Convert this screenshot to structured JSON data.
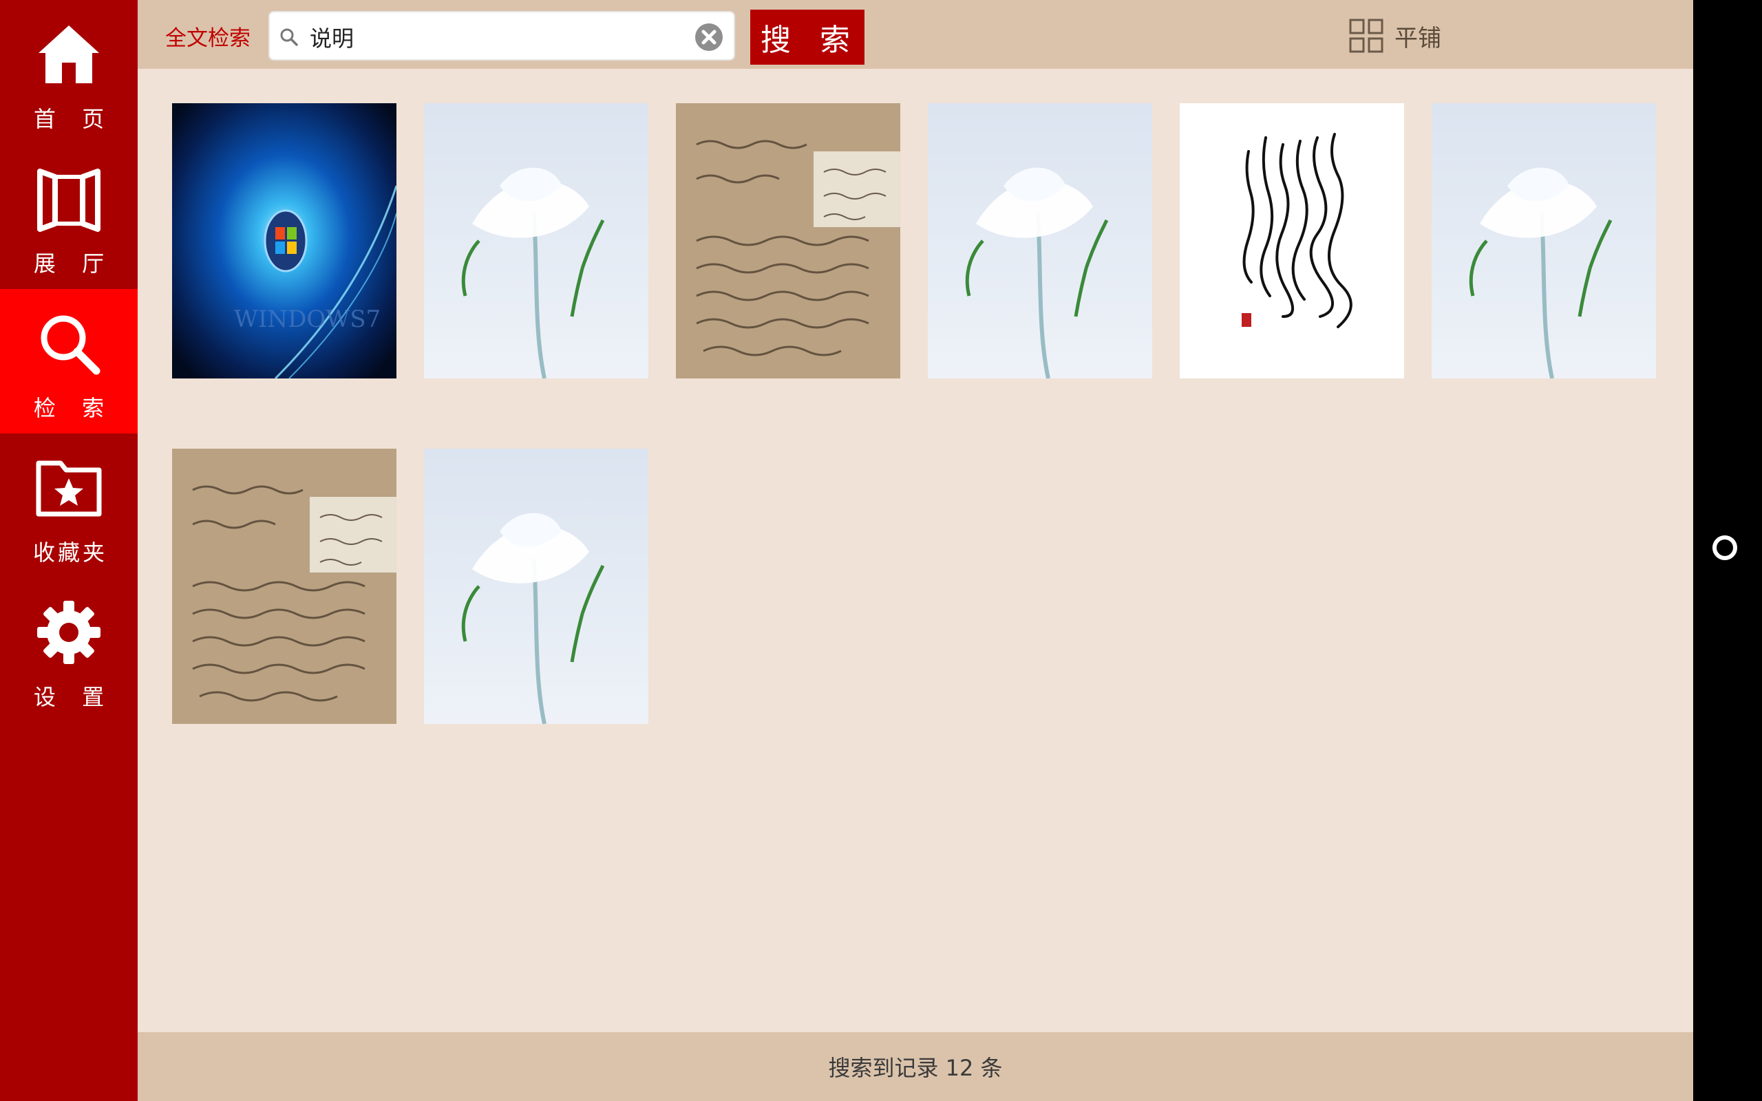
{
  "sidebar": {
    "items": [
      {
        "label": "首 页",
        "icon": "home-icon"
      },
      {
        "label": "展 厅",
        "icon": "gallery-icon"
      },
      {
        "label": "检 索",
        "icon": "search-icon",
        "active": true
      },
      {
        "label": "收藏夹",
        "icon": "favorites-folder-icon"
      },
      {
        "label": "设 置",
        "icon": "gear-icon"
      }
    ]
  },
  "topbar": {
    "search_mode": "全文检索",
    "search_value": "说明",
    "search_button": "搜 索",
    "view_toggle": "平铺"
  },
  "results": {
    "items": [
      {
        "kind": "windows7-wallpaper",
        "caption_art": "WINDOWS7"
      },
      {
        "kind": "snow-plant-photo"
      },
      {
        "kind": "handwritten-letter-scan"
      },
      {
        "kind": "snow-plant-photo"
      },
      {
        "kind": "calligraphy-scroll"
      },
      {
        "kind": "snow-plant-photo"
      },
      {
        "kind": "handwritten-letter-scan"
      },
      {
        "kind": "snow-plant-photo"
      }
    ]
  },
  "status": {
    "text": "搜索到记录 12 条"
  },
  "colors": {
    "sidebar": "#a80000",
    "sidebar_active": "#ff0000",
    "search_button": "#b50000",
    "topbar": "#dbc3ab",
    "content": "#f0e2d6"
  }
}
